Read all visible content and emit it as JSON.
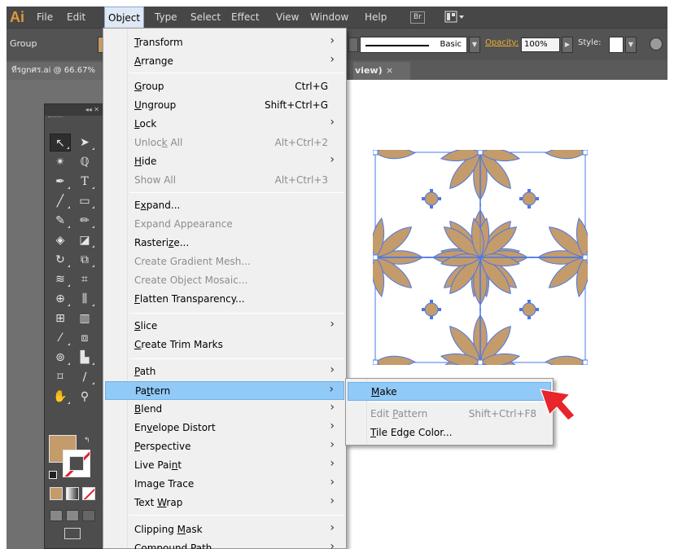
{
  "app": {
    "logo": "Ai"
  },
  "menubar": {
    "items": [
      {
        "label": "File"
      },
      {
        "label": "Edit"
      },
      {
        "label": "Object"
      },
      {
        "label": "Type"
      },
      {
        "label": "Select"
      },
      {
        "label": "Effect"
      },
      {
        "label": "View"
      },
      {
        "label": "Window"
      },
      {
        "label": "Help"
      }
    ],
    "bridge_badge": "Br"
  },
  "controlbar": {
    "selection_label": "Group",
    "stroke_profile": "Basic",
    "opacity_label": "Opacity:",
    "opacity_value": "100%",
    "style_label": "Style:"
  },
  "document": {
    "tab_title": "ทีรgnศร.ai @ 66.67%",
    "tab_tail": "view)",
    "close_glyph": "×"
  },
  "tools_panel": {
    "header_glyphs": "◂◂ ✕"
  },
  "object_menu": {
    "items": [
      {
        "label": "Transform",
        "mnemonic": "T",
        "shortcut": "",
        "submenu": true,
        "disabled": false
      },
      {
        "label": "Arrange",
        "mnemonic": "A",
        "shortcut": "",
        "submenu": true,
        "disabled": false
      },
      {
        "label": "Group",
        "mnemonic": "G",
        "shortcut": "Ctrl+G",
        "submenu": false,
        "disabled": false
      },
      {
        "label": "Ungroup",
        "mnemonic": "U",
        "shortcut": "Shift+Ctrl+G",
        "submenu": false,
        "disabled": false
      },
      {
        "label": "Lock",
        "mnemonic": "L",
        "shortcut": "",
        "submenu": true,
        "disabled": false
      },
      {
        "label": "Unlock All",
        "mnemonic": "k",
        "shortcut": "Alt+Ctrl+2",
        "submenu": false,
        "disabled": true
      },
      {
        "label": "Hide",
        "mnemonic": "H",
        "shortcut": "",
        "submenu": true,
        "disabled": false
      },
      {
        "label": "Show All",
        "mnemonic": "",
        "shortcut": "Alt+Ctrl+3",
        "submenu": false,
        "disabled": true
      },
      {
        "label": "Expand...",
        "mnemonic": "x",
        "shortcut": "",
        "submenu": false,
        "disabled": false
      },
      {
        "label": "Expand Appearance",
        "mnemonic": "",
        "shortcut": "",
        "submenu": false,
        "disabled": true
      },
      {
        "label": "Rasterize...",
        "mnemonic": "z",
        "shortcut": "",
        "submenu": false,
        "disabled": false
      },
      {
        "label": "Create Gradient Mesh...",
        "mnemonic": "",
        "shortcut": "",
        "submenu": false,
        "disabled": true
      },
      {
        "label": "Create Object Mosaic...",
        "mnemonic": "",
        "shortcut": "",
        "submenu": false,
        "disabled": true
      },
      {
        "label": "Flatten Transparency...",
        "mnemonic": "F",
        "shortcut": "",
        "submenu": false,
        "disabled": false
      },
      {
        "label": "Slice",
        "mnemonic": "S",
        "shortcut": "",
        "submenu": true,
        "disabled": false
      },
      {
        "label": "Create Trim Marks",
        "mnemonic": "C",
        "shortcut": "",
        "submenu": false,
        "disabled": false
      },
      {
        "label": "Path",
        "mnemonic": "P",
        "shortcut": "",
        "submenu": true,
        "disabled": false
      },
      {
        "label": "Pattern",
        "mnemonic": "t",
        "shortcut": "",
        "submenu": true,
        "disabled": false,
        "highlighted": true
      },
      {
        "label": "Blend",
        "mnemonic": "B",
        "shortcut": "",
        "submenu": true,
        "disabled": false
      },
      {
        "label": "Envelope Distort",
        "mnemonic": "v",
        "shortcut": "",
        "submenu": true,
        "disabled": false
      },
      {
        "label": "Perspective",
        "mnemonic": "P",
        "shortcut": "",
        "submenu": true,
        "disabled": false
      },
      {
        "label": "Live Paint",
        "mnemonic": "n",
        "shortcut": "",
        "submenu": true,
        "disabled": false
      },
      {
        "label": "Image Trace",
        "mnemonic": "",
        "shortcut": "",
        "submenu": true,
        "disabled": false
      },
      {
        "label": "Text Wrap",
        "mnemonic": "W",
        "shortcut": "",
        "submenu": true,
        "disabled": false
      },
      {
        "label": "Clipping Mask",
        "mnemonic": "M",
        "shortcut": "",
        "submenu": true,
        "disabled": false
      },
      {
        "label": "Compound Path",
        "mnemonic": "",
        "shortcut": "",
        "submenu": true,
        "disabled": false
      }
    ]
  },
  "pattern_submenu": {
    "items": [
      {
        "label": "Make",
        "mnemonic": "M",
        "shortcut": "",
        "disabled": false,
        "highlighted": true
      },
      {
        "label": "Edit Pattern",
        "mnemonic": "P",
        "shortcut": "Shift+Ctrl+F8",
        "disabled": true
      },
      {
        "label": "Tile Edge Color...",
        "mnemonic": "T",
        "shortcut": "",
        "disabled": false
      }
    ]
  },
  "colors": {
    "fill": "#c49b6b",
    "selection": "#4a78e8",
    "highlight": "#91c9f7",
    "pointer": "#e8252a",
    "opacity_label": "#f0b030"
  }
}
